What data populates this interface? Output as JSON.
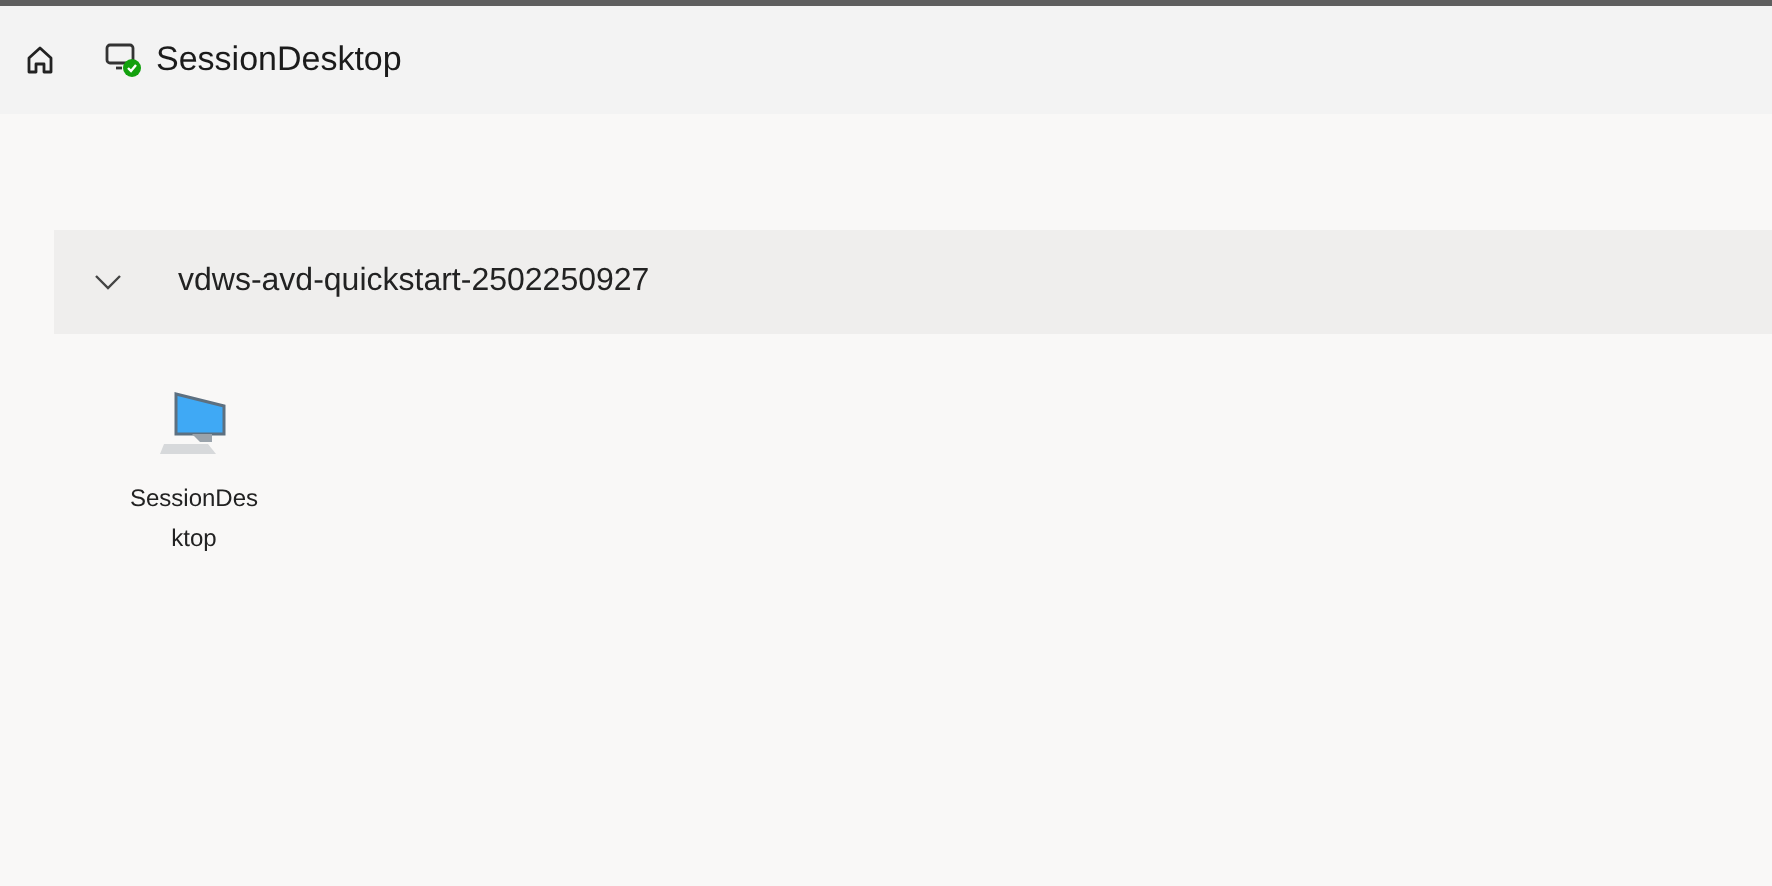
{
  "header": {
    "title": "SessionDesktop",
    "connected": true
  },
  "groups": [
    {
      "name": "vdws-avd-quickstart-2502250927",
      "expanded": true,
      "items": [
        {
          "label": "SessionDesktop"
        }
      ]
    }
  ]
}
